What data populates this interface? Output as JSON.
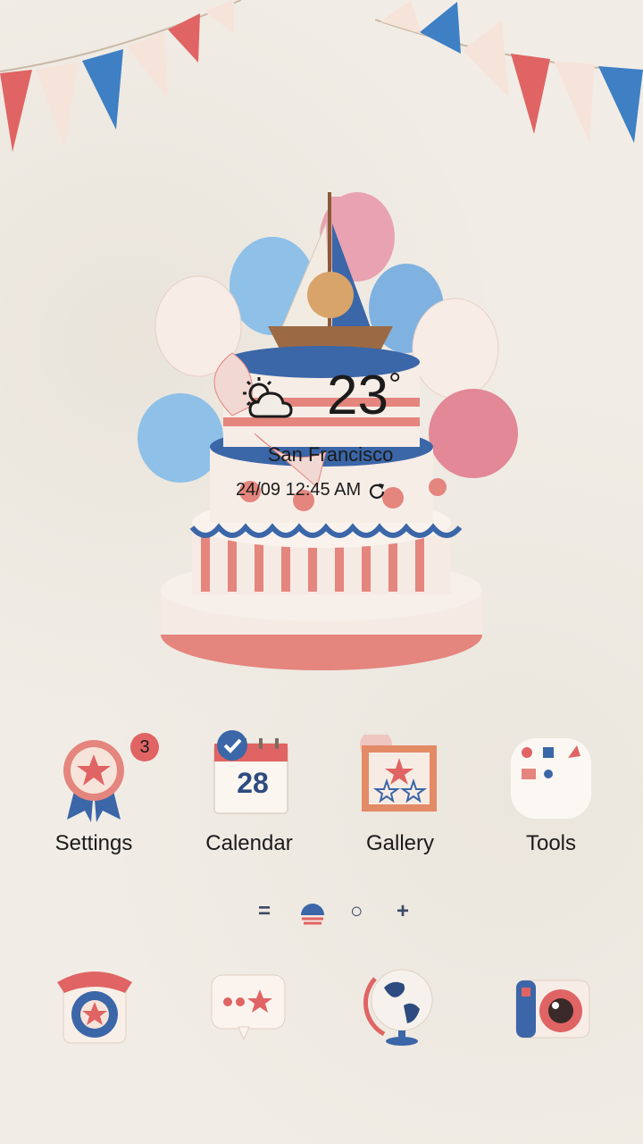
{
  "weather": {
    "temperature": "23",
    "unit": "°",
    "city": "San Francisco",
    "datetime": "24/09 12:45 AM",
    "condition_icon": "partly-cloudy-icon"
  },
  "apps": [
    {
      "label": "Settings",
      "badge": "3"
    },
    {
      "label": "Calendar",
      "date": "28"
    },
    {
      "label": "Gallery"
    },
    {
      "label": "Tools"
    }
  ],
  "pager": {
    "menu": "=",
    "home": "○",
    "add": "+"
  },
  "dock": [
    "phone-icon",
    "messages-icon",
    "browser-icon",
    "camera-icon"
  ],
  "colors": {
    "red": "#e06464",
    "blue": "#3b66a8",
    "cream": "#f1ede6"
  }
}
